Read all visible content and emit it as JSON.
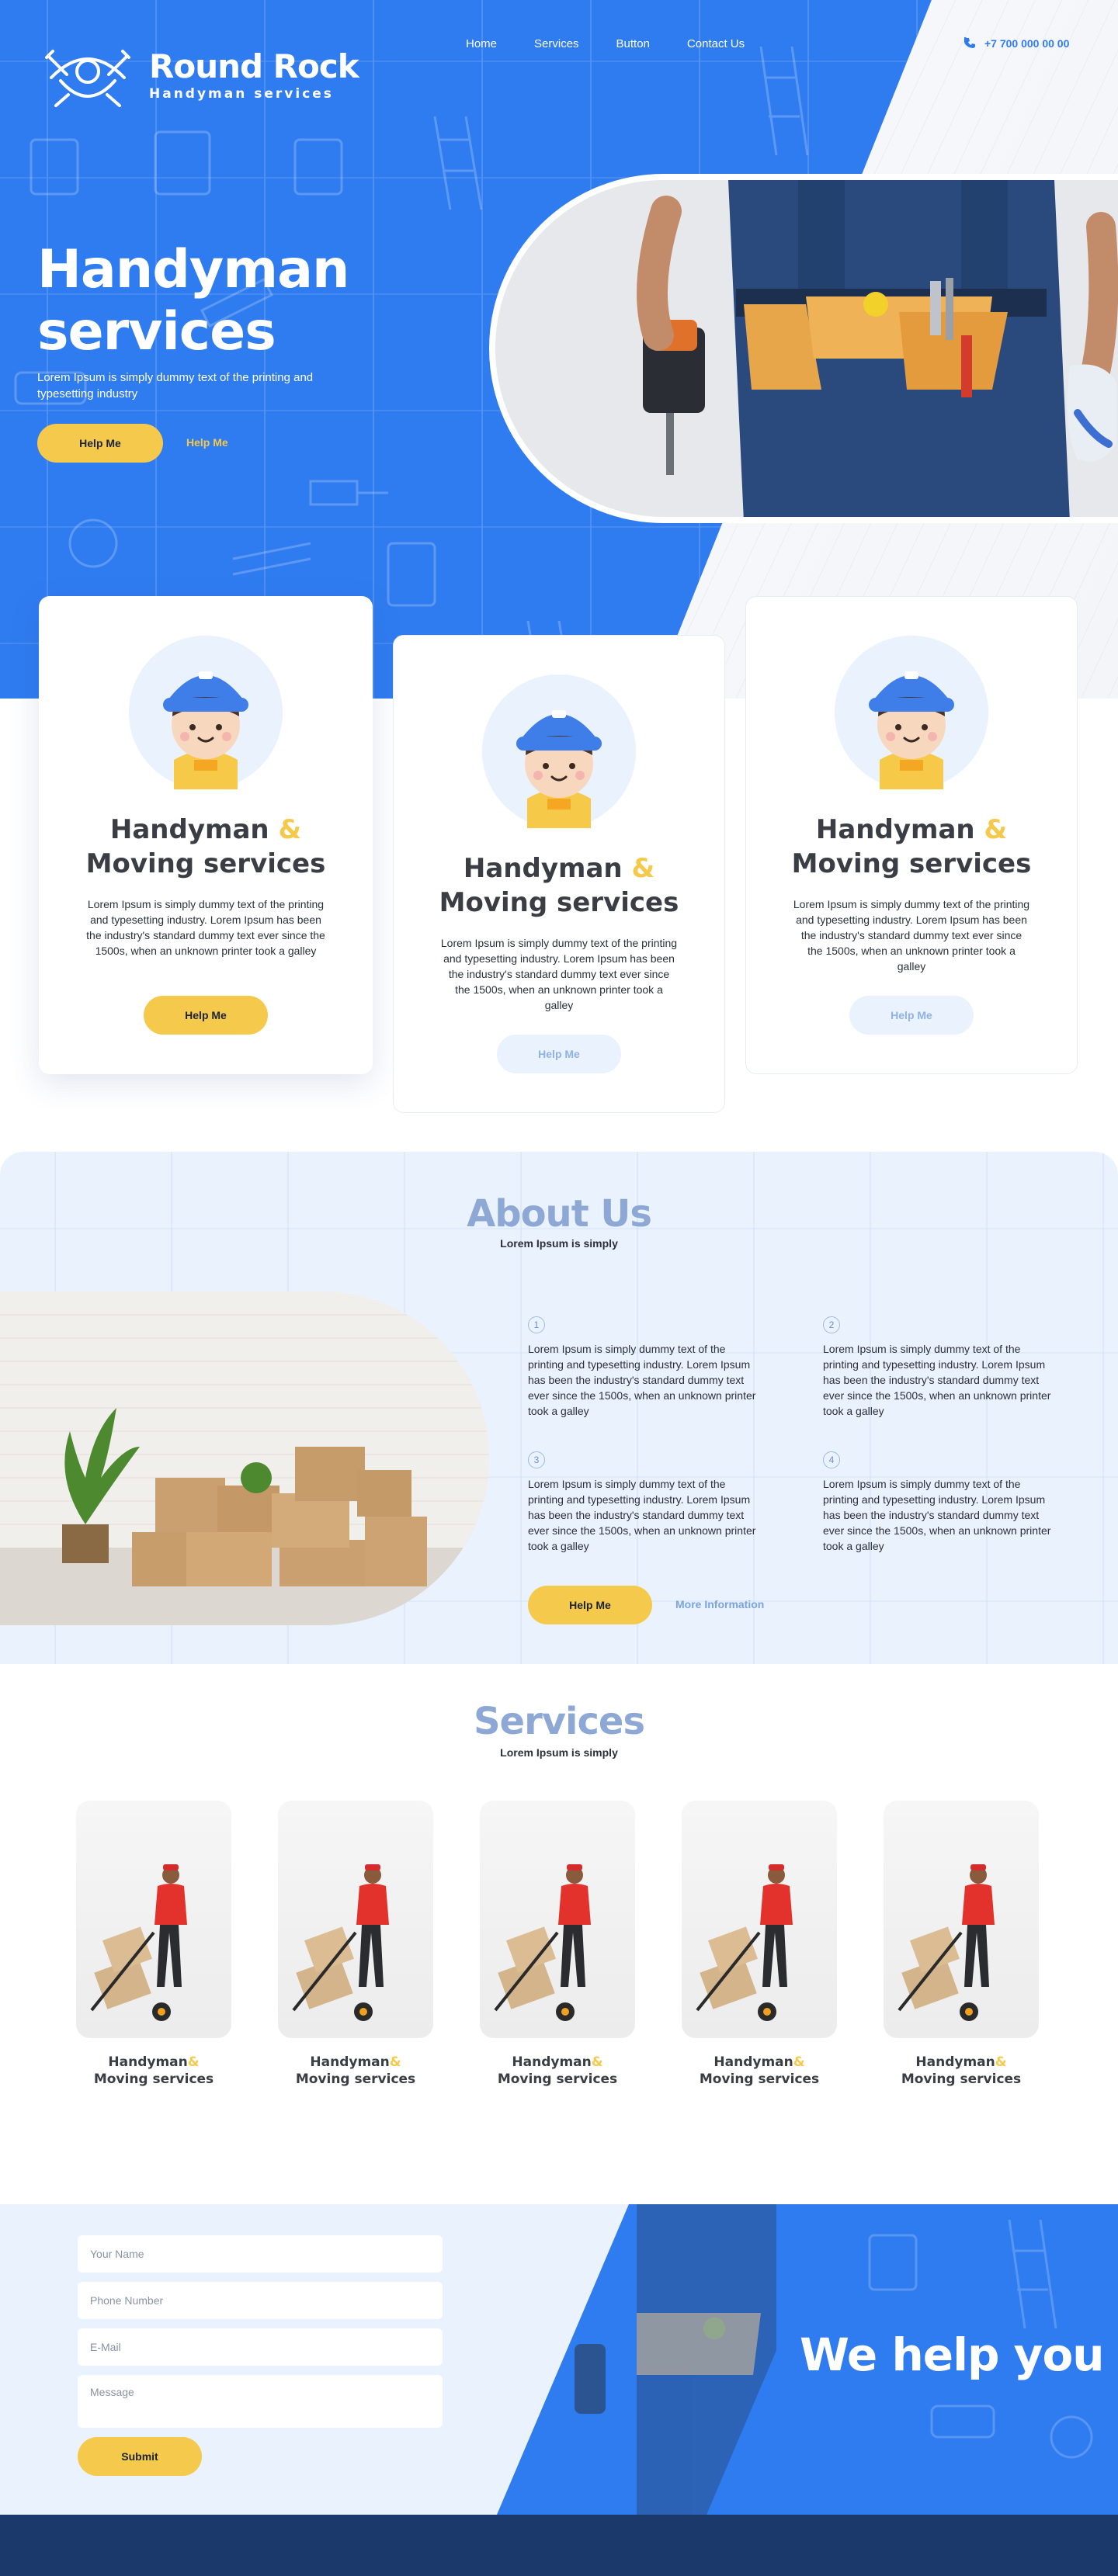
{
  "brand": {
    "name": "Round Rock",
    "tagline": "Handyman services"
  },
  "nav": {
    "items": [
      "Home",
      "Services",
      "Button",
      "Contact Us"
    ]
  },
  "header": {
    "phone": "+7 700 000 00 00"
  },
  "hero": {
    "title_line1": "Handyman",
    "title_line2": "services",
    "subtitle": "Lorem Ipsum is simply dummy text of the printing and typesetting industry",
    "primary_button": "Help Me",
    "secondary_link": "Help Me"
  },
  "cards": [
    {
      "title_part1": "Handyman",
      "amp": "&",
      "title_part2": "Moving services",
      "text": "Lorem Ipsum is simply dummy text of the printing and typesetting industry. Lorem Ipsum has been the industry's standard dummy text ever since the 1500s, when an unknown printer took a galley",
      "button": "Help Me"
    },
    {
      "title_part1": "Handyman",
      "amp": "&",
      "title_part2": "Moving services",
      "text": "Lorem Ipsum is simply dummy text of the printing and typesetting industry. Lorem Ipsum has been the industry's standard dummy text ever since the 1500s, when an unknown printer took a galley",
      "button": "Help Me"
    },
    {
      "title_part1": "Handyman",
      "amp": "&",
      "title_part2": "Moving services",
      "text": "Lorem Ipsum is simply dummy text of the printing and typesetting industry. Lorem Ipsum has been the industry's standard dummy text ever since the 1500s, when an unknown printer took a galley",
      "button": "Help Me"
    }
  ],
  "about": {
    "title": "About Us",
    "subtitle": "Lorem Ipsum is simply",
    "features": [
      {
        "num": "1",
        "text": "Lorem Ipsum is simply dummy text of the printing and typesetting industry. Lorem Ipsum has been the industry's standard dummy text ever since the 1500s, when an unknown printer took a galley"
      },
      {
        "num": "2",
        "text": "Lorem Ipsum is simply dummy text of the printing and typesetting industry. Lorem Ipsum has been the industry's standard dummy text ever since the 1500s, when an unknown printer took a galley"
      },
      {
        "num": "3",
        "text": "Lorem Ipsum is simply dummy text of the printing and typesetting industry. Lorem Ipsum has been the industry's standard dummy text ever since the 1500s, when an unknown printer took a galley"
      },
      {
        "num": "4",
        "text": "Lorem Ipsum is simply dummy text of the printing and typesetting industry. Lorem Ipsum has been the industry's standard dummy text ever since the 1500s, when an unknown printer took a galley"
      }
    ],
    "button": "Help Me",
    "link": "More Information"
  },
  "services": {
    "title": "Services",
    "subtitle": "Lorem Ipsum is simply",
    "items": [
      {
        "title_part1": "Handyman",
        "amp": "&",
        "title_part2": "Moving services"
      },
      {
        "title_part1": "Handyman",
        "amp": "&",
        "title_part2": "Moving services"
      },
      {
        "title_part1": "Handyman",
        "amp": "&",
        "title_part2": "Moving services"
      },
      {
        "title_part1": "Handyman",
        "amp": "&",
        "title_part2": "Moving services"
      },
      {
        "title_part1": "Handyman",
        "amp": "&",
        "title_part2": "Moving services"
      }
    ]
  },
  "contact": {
    "name_placeholder": "Your Name",
    "phone_placeholder": "Phone Number",
    "email_placeholder": "E-Mail",
    "message_placeholder": "Message",
    "submit": "Submit",
    "slogan": "We help you"
  },
  "colors": {
    "primary": "#2f7cf0",
    "accent": "#f4c94c",
    "light": "#eaf2fd",
    "footer": "#1b3a6b"
  }
}
